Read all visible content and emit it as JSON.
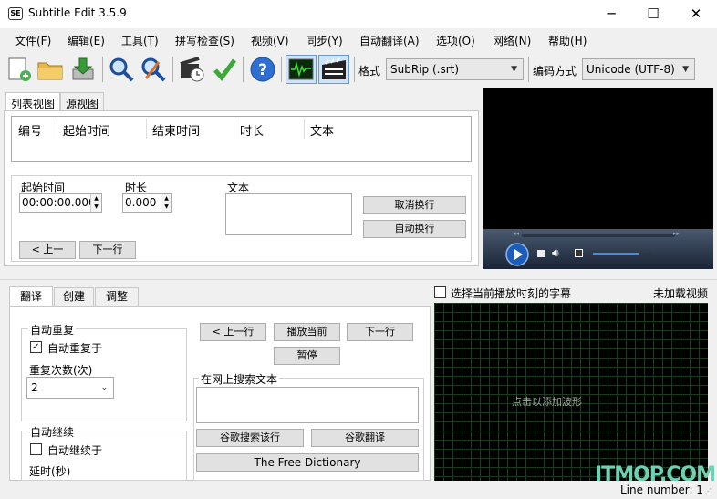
{
  "app": {
    "title": "Subtitle Edit 3.5.9",
    "icon": "SE"
  },
  "window": {
    "minimize": "─",
    "maximize": "☐",
    "close": "✕"
  },
  "menu": [
    "文件(F)",
    "编辑(E)",
    "工具(T)",
    "拼写检查(S)",
    "视频(V)",
    "同步(Y)",
    "自动翻译(A)",
    "选项(O)",
    "网络(N)",
    "帮助(H)"
  ],
  "toolbar": {
    "format_label": "格式",
    "format_value": "SubRip (.srt)",
    "encoding_label": "编码方式",
    "encoding_value": "Unicode (UTF-8)"
  },
  "tabs": {
    "list_view": "列表视图",
    "source_view": "源视图"
  },
  "table": {
    "headers": [
      "编号",
      "起始时间",
      "结束时间",
      "时长",
      "文本"
    ]
  },
  "editor": {
    "start_label": "起始时间",
    "start_value": "00:00:00.000",
    "duration_label": "时长",
    "duration_value": "0.000",
    "text_label": "文本",
    "unbreak": "取消换行",
    "auto_break": "自动换行",
    "prev": "< 上一",
    "next": "下一行"
  },
  "bottom_tabs": {
    "translate": "翻译",
    "create": "创建",
    "adjust": "调整"
  },
  "auto_repeat": {
    "title": "自动重复",
    "checkbox": "自动重复于",
    "checked": true,
    "count_label": "重复次数(次)",
    "count_value": "2"
  },
  "auto_continue": {
    "title": "自动继续",
    "checkbox": "自动继续于",
    "checked": false,
    "delay_label": "延时(秒)"
  },
  "playback": {
    "prev": "< 上一行",
    "play_current": "播放当前",
    "next": "下一行",
    "pause": "暂停"
  },
  "search": {
    "title": "在网上搜索文本",
    "google_it": "谷歌搜索该行",
    "google_translate": "谷歌翻译",
    "free_dictionary": "The Free Dictionary"
  },
  "waveform": {
    "select_checkbox": "选择当前播放时刻的字幕",
    "no_video": "未加载视频",
    "hint": "点击以添加波形"
  },
  "status": {
    "line_number": "Line number: 1"
  },
  "watermark": "ITMOP.COM",
  "colors": {
    "accent": "#1e73d8",
    "video_bg": "#000000",
    "waveform_grid": "#1f3a1f"
  }
}
